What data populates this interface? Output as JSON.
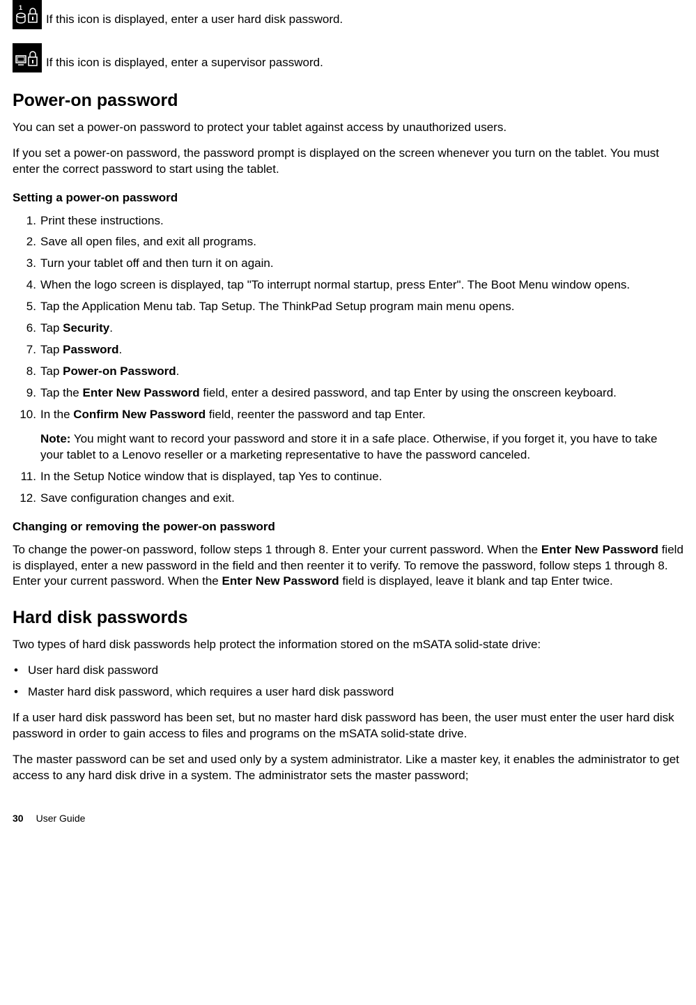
{
  "icon_row_1": {
    "text": "If this icon is displayed, enter a user hard disk password."
  },
  "icon_row_2": {
    "text": "If this icon is displayed, enter a supervisor password."
  },
  "section_poweron": {
    "heading": "Power-on password",
    "p1": "You can set a power-on password to protect your tablet against access by unauthorized users.",
    "p2": "If you set a power-on password, the password prompt is displayed on the screen whenever you turn on the tablet. You must enter the correct password to start using the tablet.",
    "subhead_setting": "Setting a power-on password",
    "steps": {
      "s1": "Print these instructions.",
      "s2": "Save all open files, and exit all programs.",
      "s3": "Turn your tablet off and then turn it on again.",
      "s4": "When the logo screen is displayed, tap \"To interrupt normal startup, press Enter\". The Boot Menu window opens.",
      "s5": "Tap the Application Menu tab. Tap Setup. The ThinkPad Setup program main menu opens.",
      "s6_pre": "Tap ",
      "s6_b": "Security",
      "s6_post": ".",
      "s7_pre": "Tap ",
      "s7_b": "Password",
      "s7_post": ".",
      "s8_pre": "Tap ",
      "s8_b": "Power-on Password",
      "s8_post": ".",
      "s9_pre": "Tap the ",
      "s9_b": "Enter New Password",
      "s9_post": " field, enter a desired password, and tap Enter by using the onscreen keyboard.",
      "s10_pre": "In the ",
      "s10_b": "Confirm New Password",
      "s10_post": " field, reenter the password and tap Enter.",
      "s10_note_label": "Note:",
      "s10_note_text": " You might want to record your password and store it in a safe place. Otherwise, if you forget it, you have to take your tablet to a Lenovo reseller or a marketing representative to have the password canceled.",
      "s11": "In the Setup Notice window that is displayed, tap Yes to continue.",
      "s12": "Save configuration changes and exit."
    },
    "subhead_changing": "Changing or removing the power-on password",
    "changing_p_pre": "To change the power-on password, follow steps 1 through 8. Enter your current password. When the ",
    "changing_p_b1": "Enter New Password",
    "changing_p_mid": " field is displayed, enter a new password in the field and then reenter it to verify. To remove the password, follow steps 1 through 8. Enter your current password. When the ",
    "changing_p_b2": "Enter New Password",
    "changing_p_post": " field is displayed, leave it blank and tap Enter twice."
  },
  "section_hdd": {
    "heading": "Hard disk passwords",
    "p1": "Two types of hard disk passwords help protect the information stored on the mSATA solid-state drive:",
    "bullets": {
      "b1": "User hard disk password",
      "b2": "Master hard disk password, which requires a user hard disk password"
    },
    "p2": "If a user hard disk password has been set, but no master hard disk password has been, the user must enter the user hard disk password in order to gain access to files and programs on the mSATA solid-state drive.",
    "p3": "The master password can be set and used only by a system administrator. Like a master key, it enables the administrator to get access to any hard disk drive in a system. The administrator sets the master password;"
  },
  "footer": {
    "page": "30",
    "title": "User Guide"
  }
}
